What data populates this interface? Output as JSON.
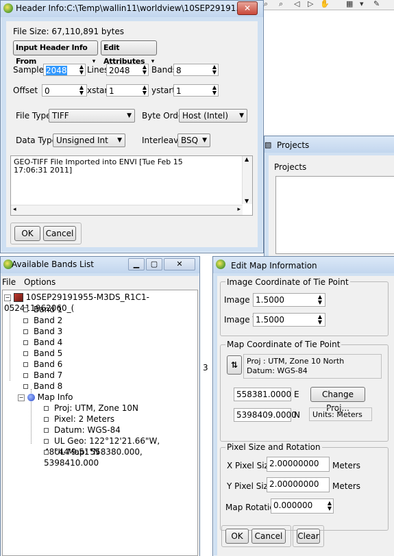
{
  "header_window": {
    "title": "Header Info:C:\\Temp\\wallin11\\worldview\\10SEP29191...",
    "file_size": "File Size: 67,110,891 bytes",
    "input_header_button": "Input Header Info From",
    "edit_attributes_button": "Edit Attributes",
    "samples_label": "Samples",
    "samples_value": "2048",
    "lines_label": "Lines",
    "lines_value": "2048",
    "bands_label": "Bands",
    "bands_value": "8",
    "offset_label": "Offset",
    "offset_value": "0",
    "xstart_label": "xstart",
    "xstart_value": "1",
    "ystart_label": "ystart",
    "ystart_value": "1",
    "file_type_label": "File Type",
    "file_type_value": "TIFF",
    "byte_order_label": "Byte Order",
    "byte_order_value": "Host (Intel)",
    "data_type_label": "Data Type",
    "data_type_value": "Unsigned Int",
    "interleave_label": "Interleave",
    "interleave_value": "BSQ",
    "description_line1": "GEO-TIFF File Imported into ENVI [Tue Feb 15",
    "description_line2": "17:06:31 2011]",
    "ok_button": "OK",
    "cancel_button": "Cancel"
  },
  "projects_window": {
    "title": "Projects",
    "label": "Projects"
  },
  "bands_window": {
    "title": "Available Bands List",
    "menu": [
      "File",
      "Options"
    ],
    "root": "10SEP29191955-M3DS_R1C1-052411962060_(",
    "bands": [
      "Band 1",
      "Band 2",
      "Band 3",
      "Band 4",
      "Band 5",
      "Band 6",
      "Band 7",
      "Band 8"
    ],
    "map_info_label": "Map Info",
    "map_info": [
      "Proj: UTM, Zone 10N",
      "Pixel: 2 Meters",
      "Datum: WGS-84",
      "UL Geo: 122°12'21.66\"W, 48°44'9.51\"N",
      "UL Map: 558380.000, 5398410.000"
    ]
  },
  "side_number": "3",
  "map_window": {
    "title": "Edit Map Information",
    "image_coord_group": "Image Coordinate of Tie Point",
    "image_x_label": "Image X",
    "image_x_value": "1.5000",
    "image_y_label": "Image Y",
    "image_y_value": "1.5000",
    "map_coord_group": "Map Coordinate of Tie Point",
    "proj_text": "Proj : UTM, Zone 10 North",
    "datum_text": "Datum: WGS-84",
    "easting_value": "558381.0000",
    "easting_label": "E",
    "northing_value": "5398409.0000",
    "northing_label": "N",
    "change_proj_button": "Change Proj...",
    "units_text": "Units: Meters",
    "pixel_group": "Pixel Size and Rotation",
    "x_pixel_label": "X Pixel Size",
    "x_pixel_value": "2.00000000",
    "x_pixel_unit": "Meters",
    "y_pixel_label": "Y Pixel Size",
    "y_pixel_value": "2.00000000",
    "y_pixel_unit": "Meters",
    "rotation_label": "Map Rotation",
    "rotation_value": "0.000000",
    "ok_button": "OK",
    "cancel_button": "Cancel",
    "clear_button": "Clear"
  }
}
